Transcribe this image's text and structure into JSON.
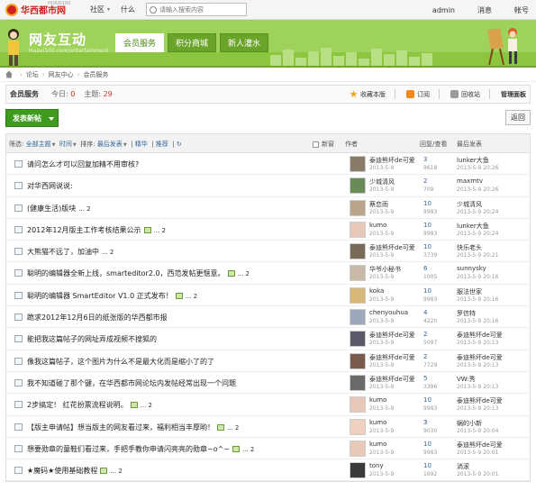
{
  "topbar": {
    "logo_text": "华西都市网",
    "logo_sup": "HUAXI100",
    "nav": [
      {
        "label": "社区"
      },
      {
        "label": "什么"
      }
    ],
    "search_placeholder": "请输入搜索内容",
    "right": [
      {
        "label": "admin"
      },
      {
        "label": "消息"
      },
      {
        "label": "帐号"
      }
    ]
  },
  "banner": {
    "title": "网友互动",
    "subtitle": "Huaxi100.com/entertainment",
    "tabs": [
      {
        "label": "会员服务"
      },
      {
        "label": "积分商城"
      },
      {
        "label": "新人灌水"
      }
    ]
  },
  "breadcrumb": [
    "论坛",
    "网友中心",
    "会员服务"
  ],
  "section": {
    "title": "会员服务",
    "today_label": "今日:",
    "today_value": "0",
    "topics_label": "主题:",
    "topics_value": "29",
    "actions": [
      {
        "label": "收藏本版"
      },
      {
        "label": "订阅"
      },
      {
        "label": "回收站"
      }
    ],
    "manage": "管理面板"
  },
  "buttons": {
    "new_post": "发表新帖",
    "back": "返回"
  },
  "list_header": {
    "filter": "筛选:",
    "all": "全部主题",
    "time": "时间",
    "sort": "排序:",
    "sort_value": "最后发表",
    "digest": "精华",
    "recommend": "推荐",
    "new_window": "新窗",
    "author": "作者",
    "reply_view": "回复/查看",
    "last_post": "最后发表"
  },
  "threads": [
    {
      "title": "请问怎么才可以回复加精不用审核?",
      "pages": "",
      "pic": false,
      "author": "泰迪熊坏de可爱",
      "date": "2013-5-9",
      "replies": "3",
      "views": "9618",
      "last_user": "lunker大鱼",
      "last_time": "2013-5-9 20:26"
    },
    {
      "title": "对华西网说说:",
      "pages": "",
      "pic": false,
      "author": "少城清风",
      "date": "2013-5-9",
      "replies": "2",
      "views": "709",
      "last_user": "maxmtv",
      "last_time": "2013-5-9 20:26"
    },
    {
      "title": "(健康生活)版块",
      "pages": "... 2",
      "pic": false,
      "author": "蔡恋雨",
      "date": "2013-5-9",
      "replies": "10",
      "views": "9983",
      "last_user": "少城清风",
      "last_time": "2013-5-9 20:24"
    },
    {
      "title": "2012年12月版主工作考核结果公示",
      "pages": "... 2",
      "pic": true,
      "author": "kumo",
      "date": "2013-5-9",
      "replies": "10",
      "views": "9983",
      "last_user": "lunker大鱼",
      "last_time": "2013-5-9 20:24"
    },
    {
      "title": "大熊猫不远了，加油中",
      "pages": "... 2",
      "pic": false,
      "author": "泰迪熊坏de可爱",
      "date": "2013-5-9",
      "replies": "10",
      "views": "3739",
      "last_user": "快乐老头",
      "last_time": "2013-5-9 20:21"
    },
    {
      "title": "聪明的编辑器全新上线，smarteditor2.0，西范发帖更惬意。",
      "pages": "... 2",
      "pic": true,
      "author": "华爷小秘书",
      "date": "2013-5-9",
      "replies": "6",
      "views": "1005",
      "last_user": "sunnysky",
      "last_time": "2013-5-9 20:16"
    },
    {
      "title": "聪明的编辑器 SmartEditor V1.0 正式发布！",
      "pages": "... 2",
      "pic": true,
      "author": "koka",
      "date": "2013-5-9",
      "replies": "10",
      "views": "9983",
      "last_user": "服法世家",
      "last_time": "2013-5-9 20:16"
    },
    {
      "title": "跪求2012年12月6日的纸张版的华西都市报",
      "pages": "",
      "pic": false,
      "author": "chenyouhua",
      "date": "2013-5-9",
      "replies": "4",
      "views": "4220",
      "last_user": "罗信特",
      "last_time": "2013-5-9 20:16"
    },
    {
      "title": "能把我这篇帖子的网址弄成视频不搜狐的",
      "pages": "",
      "pic": false,
      "author": "泰迪熊坏de可爱",
      "date": "2013-5-9",
      "replies": "2",
      "views": "5097",
      "last_user": "泰迪熊坏de可爱",
      "last_time": "2013-5-9 20:13"
    },
    {
      "title": "像我这篇帖子，这个图片为什么不是最大化而是缩小了的了",
      "pages": "",
      "pic": false,
      "author": "泰迪熊坏de可爱",
      "date": "2013-5-9",
      "replies": "2",
      "views": "7729",
      "last_user": "泰迪熊坏de可爱",
      "last_time": "2013-5-9 20:13"
    },
    {
      "title": "我不知道碰了那个键，在华西都市网论坛内发帖经常出现一个问题",
      "pages": "",
      "pic": false,
      "author": "泰迪熊坏de可爱",
      "date": "2013-5-9",
      "replies": "5",
      "views": "3396",
      "last_user": "VW:秀",
      "last_time": "2013-5-9 20:13"
    },
    {
      "title": "2步搞定！ 红花扮票流程说明。",
      "pages": "... 2",
      "pic": true,
      "author": "kumo",
      "date": "2013-5-9",
      "replies": "10",
      "views": "9983",
      "last_user": "泰迪熊坏de可爱",
      "last_time": "2013-5-9 20:13"
    },
    {
      "title": "【版主申请帖】想当版主的网友看过来，福利相当丰厚哟！",
      "pages": "... 2",
      "pic": true,
      "author": "kumo",
      "date": "2013-5-9",
      "replies": "3",
      "views": "9030",
      "last_user": "蜗的小新",
      "last_time": "2013-5-9 20:04"
    },
    {
      "title": "想要勋章的童鞋们看过来，手把手教你申请闪亮亮的勋章~o^~",
      "pages": "... 2",
      "pic": true,
      "author": "kumo",
      "date": "2013-5-9",
      "replies": "10",
      "views": "9983",
      "last_user": "泰迪熊坏de可爱",
      "last_time": "2013-5-9 20:01"
    },
    {
      "title": "★魔码★使用基础教程",
      "pages": "... 2",
      "pic": true,
      "author": "tony",
      "date": "2013-5-9",
      "replies": "10",
      "views": "1692",
      "last_user": "淌滚",
      "last_time": "2013-5-9 20:01"
    }
  ],
  "colors": {
    "brand_green": "#8cc63f",
    "button_green": "#3e9b1e",
    "red": "#d32020",
    "link_blue": "#336699"
  }
}
